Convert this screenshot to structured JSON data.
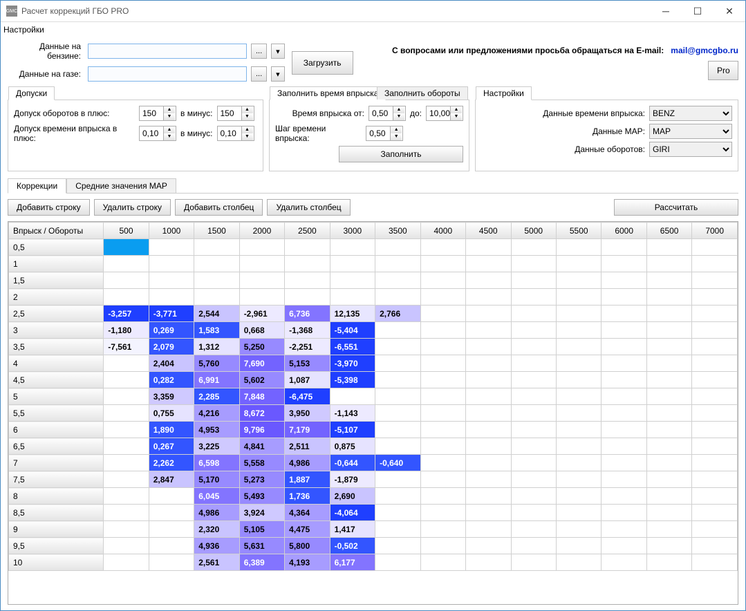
{
  "window_title": "Расчет коррекций ГБО PRO",
  "settings_label": "Настройки",
  "benzine_label": "Данные на бензине:",
  "gas_label": "Данные на газе:",
  "load_button": "Загрузить",
  "contact_text": "С вопросами или предложениями просьба обращаться на E-mail:",
  "contact_email": "mail@gmcgbo.ru",
  "pro_button": "Pro",
  "tolerances_tab": "Допуски",
  "tol_rpm_plus_label": "Допуск оборотов в плюс:",
  "tol_rpm_minus_label": "в минус:",
  "tol_rpm_plus": "150",
  "tol_rpm_minus": "150",
  "tol_inj_plus_label": "Допуск времени впрыска в плюс:",
  "tol_inj_minus_label": "в минус:",
  "tol_inj_plus": "0,10",
  "tol_inj_minus": "0,10",
  "fill_inj_tab": "Заполнить время впрыска",
  "fill_rpm_tab": "Заполнить обороты",
  "inj_from_label": "Время впрыска от:",
  "inj_to_label": "до:",
  "inj_from": "0,50",
  "inj_to": "10,00",
  "inj_step_label": "Шаг времени впрыска:",
  "inj_step": "0,50",
  "fill_button": "Заполнить",
  "right_tab": "Настройки",
  "data_inj_label": "Данные времени впрыска:",
  "data_inj_value": "BENZ",
  "data_map_label": "Данные MAP:",
  "data_map_value": "MAP",
  "data_rpm_label": "Данные оборотов:",
  "data_rpm_value": "GIRI",
  "main_tab1": "Коррекции",
  "main_tab2": "Средние значения MAP",
  "btn_add_row": "Добавить строку",
  "btn_del_row": "Удалить строку",
  "btn_add_col": "Добавить столбец",
  "btn_del_col": "Удалить столбец",
  "btn_calc": "Рассчитать",
  "corner_label": "Впрыск / Обороты",
  "col_headers": [
    "500",
    "1000",
    "1500",
    "2000",
    "2500",
    "3000",
    "3500",
    "4000",
    "4500",
    "5000",
    "5500",
    "6000",
    "6500",
    "7000"
  ],
  "row_headers": [
    "0,5",
    "1",
    "1,5",
    "2",
    "2,5",
    "3",
    "3,5",
    "4",
    "4,5",
    "5",
    "5,5",
    "6",
    "6,5",
    "7",
    "7,5",
    "8",
    "8,5",
    "9",
    "9,5",
    "10"
  ],
  "cells": {
    "2,5": {
      "500": "-3,257",
      "1000": "-3,771",
      "1500": "2,544",
      "2000": "-2,961",
      "2500": "6,736",
      "3000": "12,135",
      "3500": "2,766"
    },
    "3": {
      "500": "-1,180",
      "1000": "0,269",
      "1500": "1,583",
      "2000": "0,668",
      "2500": "-1,368",
      "3000": "-5,404"
    },
    "3,5": {
      "500": "-7,561",
      "1000": "2,079",
      "1500": "1,312",
      "2000": "5,250",
      "2500": "-2,251",
      "3000": "-6,551"
    },
    "4": {
      "1000": "2,404",
      "1500": "5,760",
      "2000": "7,690",
      "2500": "5,153",
      "3000": "-3,970"
    },
    "4,5": {
      "1000": "0,282",
      "1500": "6,991",
      "2000": "5,602",
      "2500": "1,087",
      "3000": "-5,398"
    },
    "5": {
      "1000": "3,359",
      "1500": "2,285",
      "2000": "7,848",
      "2500": "-6,475"
    },
    "5,5": {
      "1000": "0,755",
      "1500": "4,216",
      "2000": "8,672",
      "2500": "3,950",
      "3000": "-1,143"
    },
    "6": {
      "1000": "1,890",
      "1500": "4,953",
      "2000": "9,796",
      "2500": "7,179",
      "3000": "-5,107"
    },
    "6,5": {
      "1000": "0,267",
      "1500": "3,225",
      "2000": "4,841",
      "2500": "2,511",
      "3000": "0,875"
    },
    "7": {
      "1000": "2,262",
      "1500": "6,598",
      "2000": "5,558",
      "2500": "4,986",
      "3000": "-0,644",
      "3500": "-0,640"
    },
    "7,5": {
      "1000": "2,847",
      "1500": "5,170",
      "2000": "5,273",
      "2500": "1,887",
      "3000": "-1,879"
    },
    "8": {
      "1500": "6,045",
      "2000": "5,493",
      "2500": "1,736",
      "3000": "2,690"
    },
    "8,5": {
      "1500": "4,986",
      "2000": "3,924",
      "2500": "4,364",
      "3000": "-4,064"
    },
    "9": {
      "1500": "2,320",
      "2000": "5,105",
      "2500": "4,475",
      "3000": "1,417"
    },
    "9,5": {
      "1500": "4,936",
      "2000": "5,631",
      "2500": "5,800",
      "3000": "-0,502"
    },
    "10": {
      "1500": "2,561",
      "2000": "6,389",
      "2500": "4,193",
      "3000": "6,177"
    }
  },
  "chart_data": {
    "type": "table",
    "title": "Коррекции",
    "xlabel": "Обороты",
    "ylabel": "Впрыск",
    "x": [
      500,
      1000,
      1500,
      2000,
      2500,
      3000,
      3500,
      4000,
      4500,
      5000,
      5500,
      6000,
      6500,
      7000
    ],
    "y": [
      0.5,
      1,
      1.5,
      2,
      2.5,
      3,
      3.5,
      4,
      4.5,
      5,
      5.5,
      6,
      6.5,
      7,
      7.5,
      8,
      8.5,
      9,
      9.5,
      10
    ],
    "grid": [
      [
        null,
        null,
        null,
        null,
        null,
        null,
        null,
        null,
        null,
        null,
        null,
        null,
        null,
        null
      ],
      [
        null,
        null,
        null,
        null,
        null,
        null,
        null,
        null,
        null,
        null,
        null,
        null,
        null,
        null
      ],
      [
        null,
        null,
        null,
        null,
        null,
        null,
        null,
        null,
        null,
        null,
        null,
        null,
        null,
        null
      ],
      [
        null,
        null,
        null,
        null,
        null,
        null,
        null,
        null,
        null,
        null,
        null,
        null,
        null,
        null
      ],
      [
        -3.257,
        -3.771,
        2.544,
        -2.961,
        6.736,
        12.135,
        2.766,
        null,
        null,
        null,
        null,
        null,
        null,
        null
      ],
      [
        -1.18,
        0.269,
        1.583,
        0.668,
        -1.368,
        -5.404,
        null,
        null,
        null,
        null,
        null,
        null,
        null,
        null
      ],
      [
        -7.561,
        2.079,
        1.312,
        5.25,
        -2.251,
        -6.551,
        null,
        null,
        null,
        null,
        null,
        null,
        null,
        null
      ],
      [
        null,
        2.404,
        5.76,
        7.69,
        5.153,
        -3.97,
        null,
        null,
        null,
        null,
        null,
        null,
        null,
        null
      ],
      [
        null,
        0.282,
        6.991,
        5.602,
        1.087,
        -5.398,
        null,
        null,
        null,
        null,
        null,
        null,
        null,
        null
      ],
      [
        null,
        3.359,
        2.285,
        7.848,
        -6.475,
        null,
        null,
        null,
        null,
        null,
        null,
        null,
        null,
        null
      ],
      [
        null,
        0.755,
        4.216,
        8.672,
        3.95,
        -1.143,
        null,
        null,
        null,
        null,
        null,
        null,
        null,
        null
      ],
      [
        null,
        1.89,
        4.953,
        9.796,
        7.179,
        -5.107,
        null,
        null,
        null,
        null,
        null,
        null,
        null,
        null
      ],
      [
        null,
        0.267,
        3.225,
        4.841,
        2.511,
        0.875,
        null,
        null,
        null,
        null,
        null,
        null,
        null,
        null
      ],
      [
        null,
        2.262,
        6.598,
        5.558,
        4.986,
        -0.644,
        -0.64,
        null,
        null,
        null,
        null,
        null,
        null,
        null
      ],
      [
        null,
        2.847,
        5.17,
        5.273,
        1.887,
        -1.879,
        null,
        null,
        null,
        null,
        null,
        null,
        null,
        null
      ],
      [
        null,
        null,
        6.045,
        5.493,
        1.736,
        2.69,
        null,
        null,
        null,
        null,
        null,
        null,
        null,
        null
      ],
      [
        null,
        null,
        4.986,
        3.924,
        4.364,
        -4.064,
        null,
        null,
        null,
        null,
        null,
        null,
        null,
        null
      ],
      [
        null,
        null,
        2.32,
        5.105,
        4.475,
        1.417,
        null,
        null,
        null,
        null,
        null,
        null,
        null,
        null
      ],
      [
        null,
        null,
        4.936,
        5.631,
        5.8,
        -0.502,
        null,
        null,
        null,
        null,
        null,
        null,
        null,
        null
      ],
      [
        null,
        null,
        2.561,
        6.389,
        4.193,
        6.177,
        null,
        null,
        null,
        null,
        null,
        null,
        null,
        null
      ]
    ]
  }
}
